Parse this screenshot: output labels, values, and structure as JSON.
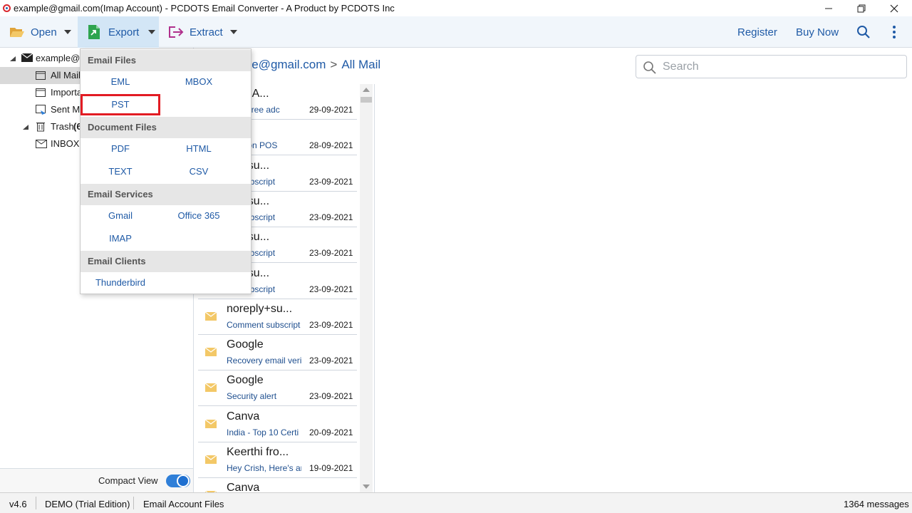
{
  "window": {
    "title": "example@gmail.com(Imap Account) - PCDOTS Email Converter - A Product by PCDOTS Inc",
    "minimize": "–",
    "restore": "❐",
    "close": "✕"
  },
  "toolbar": {
    "open_label": "Open",
    "export_label": "Export",
    "extract_label": "Extract",
    "register_label": "Register",
    "buy_now_label": "Buy Now"
  },
  "tree": {
    "account": "example@",
    "folders": [
      {
        "label": "All Mail"
      },
      {
        "label": "Importa"
      },
      {
        "label": "Sent Ma"
      },
      {
        "label": "Trash",
        "count": "(6"
      },
      {
        "label": "INBOX"
      }
    ]
  },
  "compact_view": {
    "label": "Compact View",
    "enabled": true
  },
  "breadcrumb": {
    "account": "ple@gmail.com",
    "separator": ">",
    "folder": "All Mail"
  },
  "search": {
    "placeholder": "Search",
    "value": ""
  },
  "export_menu": {
    "sections": [
      {
        "title": "Email Files",
        "items": [
          "EML",
          "MBOX",
          "PST"
        ]
      },
      {
        "title": "Document Files",
        "items": [
          "PDF",
          "HTML",
          "TEXT",
          "CSV"
        ]
      },
      {
        "title": "Email Services",
        "items": [
          "Gmail",
          "Office 365",
          "IMAP"
        ]
      },
      {
        "title": "Email Clients",
        "items": [
          "Thunderbird"
        ]
      }
    ],
    "highlighted_item": "PST"
  },
  "mail_list": [
    {
      "from": "from A...",
      "snippet": "er - A free adc",
      "date": "29-09-2021"
    },
    {
      "from": "o",
      "snippet": "gn in on POS",
      "date": "28-09-2021"
    },
    {
      "from": "ply+su...",
      "snippet": "ent subscript",
      "date": "23-09-2021"
    },
    {
      "from": "ply+su...",
      "snippet": "ent subscript",
      "date": "23-09-2021"
    },
    {
      "from": "ply+su...",
      "snippet": "ent subscript",
      "date": "23-09-2021"
    },
    {
      "from": "ply+su...",
      "snippet": "ent subscript",
      "date": "23-09-2021"
    },
    {
      "from": "noreply+su...",
      "snippet": "Comment subscript",
      "date": "23-09-2021"
    },
    {
      "from": "Google",
      "snippet": "Recovery email veri",
      "date": "23-09-2021"
    },
    {
      "from": "Google",
      "snippet": "Security alert",
      "date": "23-09-2021"
    },
    {
      "from": "Canva",
      "snippet": "India - Top 10 Certi",
      "date": "20-09-2021"
    },
    {
      "from": "Keerthi fro...",
      "snippet": "Hey Crish, Here's ar",
      "date": "19-09-2021"
    },
    {
      "from": "Canva",
      "snippet": "",
      "date": ""
    }
  ],
  "status": {
    "version": "v4.6",
    "edition": "DEMO (Trial Edition)",
    "mode": "Email Account Files",
    "message_count": "1364 messages"
  },
  "colors": {
    "accent": "#1f5aa6",
    "toolbar_bg": "#f1f6fb",
    "export_active_bg": "#d3e6f6",
    "highlight_border": "#e21b23",
    "envelope": "#f3c867"
  }
}
